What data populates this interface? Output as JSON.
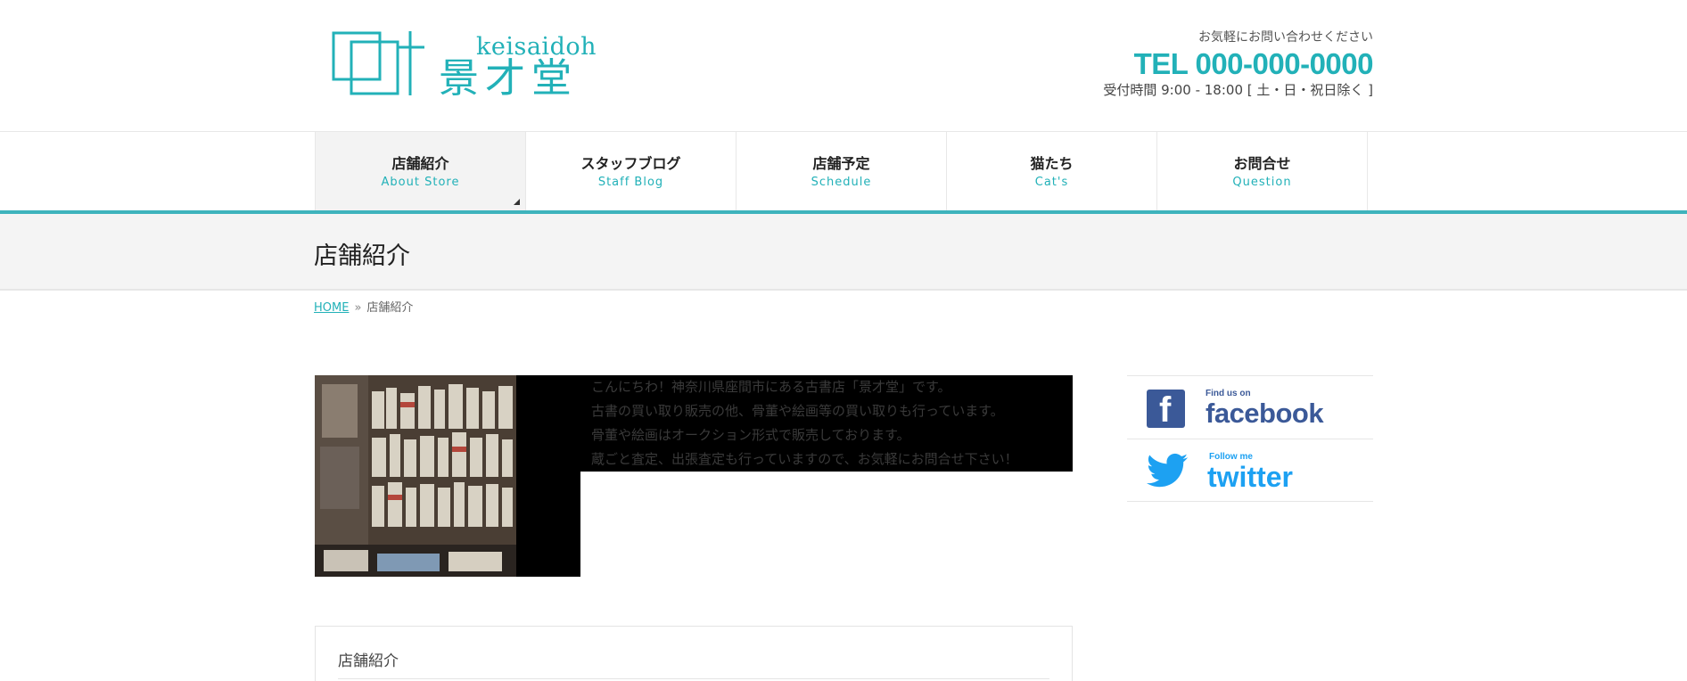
{
  "header": {
    "logo": {
      "latin": "keisaidoh",
      "kanji": "景才堂"
    },
    "contact_lead": "お気軽にお問い合わせください",
    "tel": "TEL 000-000-0000",
    "hours": "受付時間 9:00 - 18:00 [ 土・日・祝日除く ]"
  },
  "nav": [
    {
      "jp": "店舗紹介",
      "en": "About Store"
    },
    {
      "jp": "スタッフブログ",
      "en": "Staff Blog"
    },
    {
      "jp": "店舗予定",
      "en": "Schedule"
    },
    {
      "jp": "猫たち",
      "en": "Cat's"
    },
    {
      "jp": "お問合せ",
      "en": "Question"
    }
  ],
  "page": {
    "title": "店舗紹介",
    "breadcrumb": {
      "home": "HOME",
      "sep": "»",
      "current": "店舗紹介"
    }
  },
  "intro": [
    "こんにちわ！神奈川県座間市にある古書店「景才堂」です。",
    "古書の買い取り販売の他、骨董や絵画等の買い取りも行っています。",
    "骨董や絵画はオークション形式で販売しております。",
    "蔵ごと査定、出張査定も行っていますので、お気軽にお問合せ下さい！"
  ],
  "section": {
    "title": "店舗紹介"
  },
  "sidebar": {
    "facebook": {
      "small": "Find us on",
      "big": "facebook"
    },
    "twitter": {
      "small": "Follow me",
      "big": "twitter"
    }
  },
  "colors": {
    "accent": "#22b1b8",
    "facebook": "#3b5998",
    "twitter": "#1da1f2"
  }
}
